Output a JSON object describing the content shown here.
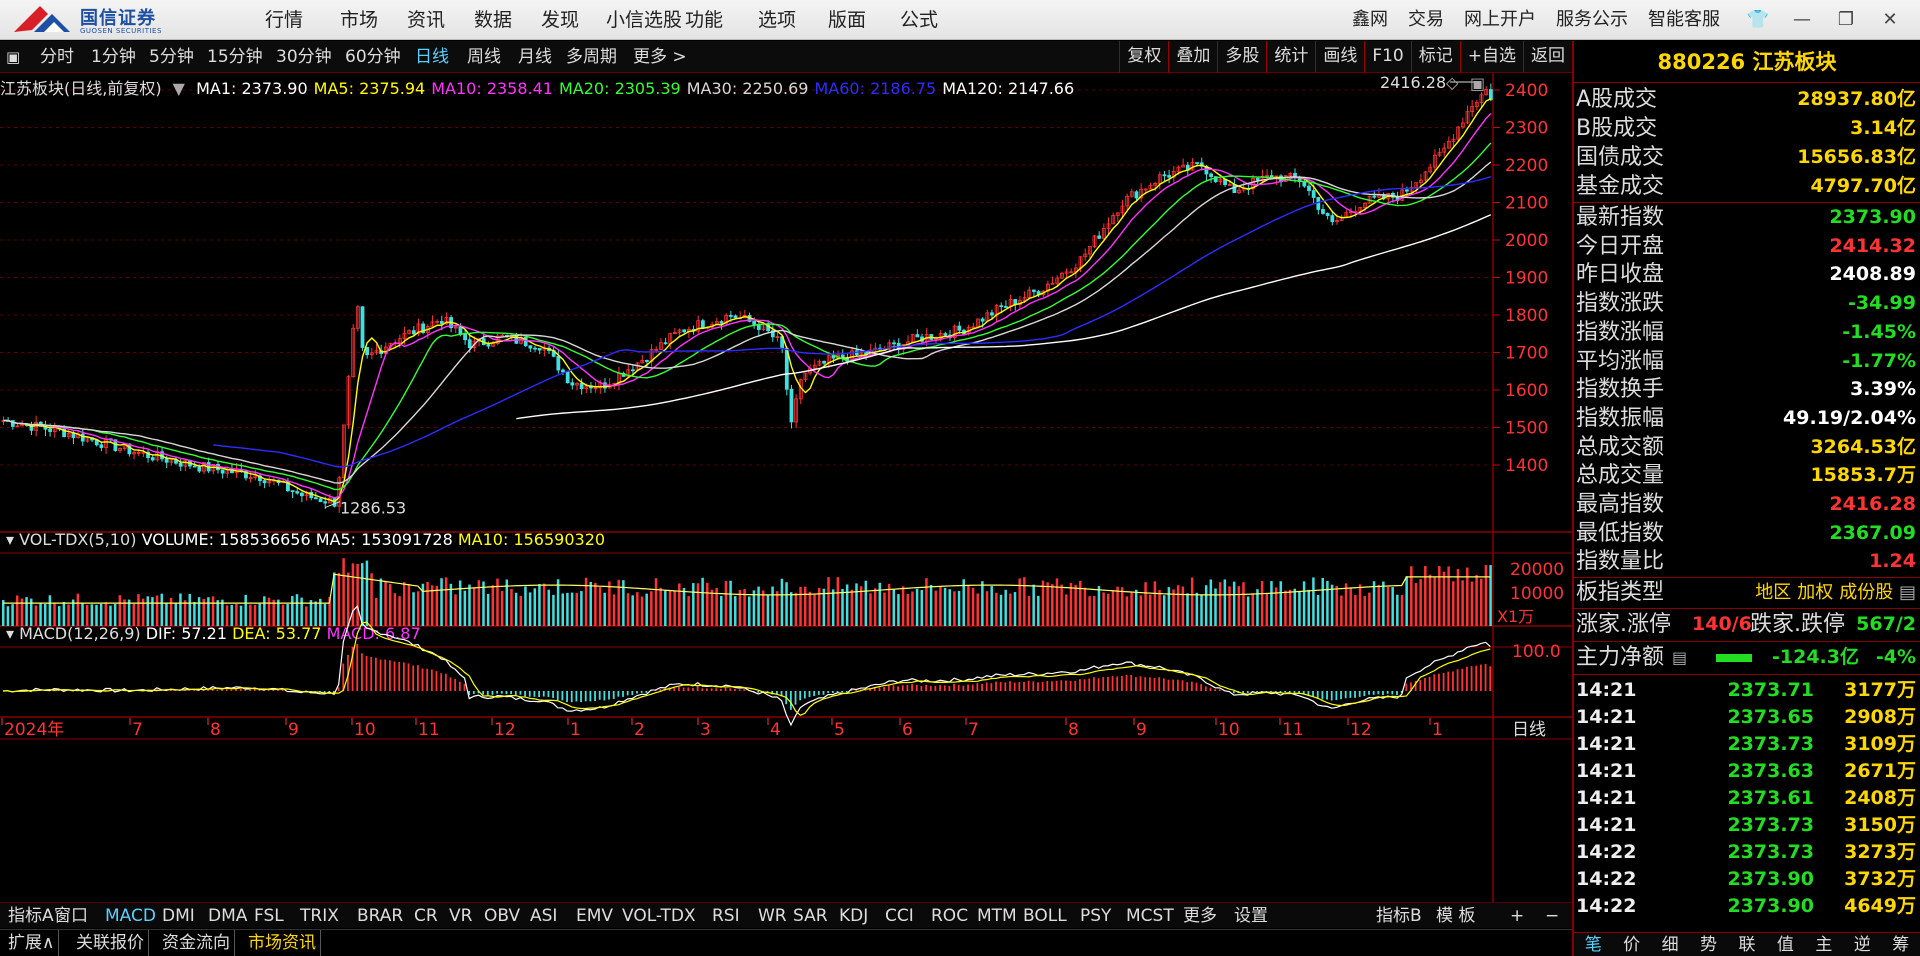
{
  "brand": {
    "name": "国信证券",
    "sub": "GUOSEN SECURITIES"
  },
  "menu": [
    "行情",
    "市场",
    "资讯",
    "数据",
    "发现",
    "小信选股",
    "功能",
    "选项",
    "版面",
    "公式"
  ],
  "right_menu": [
    "鑫网",
    "交易",
    "网上开户",
    "服务公示",
    "智能客服"
  ],
  "window_controls": [
    "shirt-icon",
    "minimize-icon",
    "restore-icon",
    "close-icon"
  ],
  "periods": [
    "分时",
    "1分钟",
    "5分钟",
    "15分钟",
    "30分钟",
    "60分钟",
    "日线",
    "周线",
    "月线",
    "多周期",
    "更多 >"
  ],
  "active_period": "日线",
  "tools": [
    "复权",
    "叠加",
    "多股",
    "统计",
    "画线",
    "F10",
    "标记",
    "+自选",
    "返回"
  ],
  "main_chart": {
    "legend_title": "江苏板块(日线,前复权)",
    "ma": [
      {
        "label": "MA1: 2373.90",
        "color": "#ffffff"
      },
      {
        "label": "MA5: 2375.94",
        "color": "#ffff00"
      },
      {
        "label": "MA10: 2358.41",
        "color": "#ff33ff"
      },
      {
        "label": "MA20: 2305.39",
        "color": "#33ff33"
      },
      {
        "label": "MA30: 2250.69",
        "color": "#d8d8d8"
      },
      {
        "label": "MA60: 2186.75",
        "color": "#2d2dff"
      },
      {
        "label": "MA120: 2147.66",
        "color": "#ffffff"
      }
    ],
    "y_ticks": [
      2400,
      2300,
      2200,
      2100,
      2000,
      1900,
      1800,
      1700,
      1600,
      1500,
      1400
    ],
    "high_label": "2416.28",
    "low_label": "1286.53"
  },
  "volume": {
    "legend_name": "VOL-TDX(5,10)",
    "legend_volume": "VOLUME: 158536656",
    "legend_ma5": "MA5: 153091728",
    "legend_ma10": "MA10: 156590320",
    "y_ticks": [
      "20000",
      "10000"
    ],
    "unit": "X1万"
  },
  "macd": {
    "legend_name": "MACD(12,26,9)",
    "legend_dif": "DIF: 57.21",
    "legend_dea": "DEA: 53.77",
    "legend_macd": "MACD: 6.87",
    "y_tick": "100.0"
  },
  "x_axis": {
    "labels": [
      "2024年",
      "7",
      "8",
      "9",
      "10",
      "11",
      "12",
      "1",
      "2",
      "3",
      "4",
      "5",
      "6",
      "7",
      "8",
      "9",
      "10",
      "11",
      "12",
      "1"
    ],
    "corner": "日线"
  },
  "indicators": [
    "指标A",
    "窗口",
    "MACD",
    "DMI",
    "DMA",
    "FSL",
    "TRIX",
    "BRAR",
    "CR",
    "VR",
    "OBV",
    "ASI",
    "EMV",
    "VOL-TDX",
    "RSI",
    "WR",
    "SAR",
    "KDJ",
    "CCI",
    "ROC",
    "MTM",
    "BOLL",
    "PSY",
    "MCST",
    "更多",
    "设置"
  ],
  "indicator_right": [
    "指标B",
    "模 板",
    "+",
    "−"
  ],
  "active_indicator": "MACD",
  "extra_tabs": [
    "扩展∧",
    "关联报价",
    "资金流向",
    "市场资讯"
  ],
  "active_extra": "市场资讯",
  "panel": {
    "title": "880226 江苏板块",
    "turnover": [
      {
        "label": "A股成交",
        "value": "28937.80亿",
        "color": "#ffd700"
      },
      {
        "label": "B股成交",
        "value": "3.14亿",
        "color": "#ffd700"
      },
      {
        "label": "国债成交",
        "value": "15656.83亿",
        "color": "#ffd700"
      },
      {
        "label": "基金成交",
        "value": "4797.70亿",
        "color": "#ffd700"
      }
    ],
    "stats": [
      {
        "label": "最新指数",
        "value": "2373.90",
        "color": "#22dd22"
      },
      {
        "label": "今日开盘",
        "value": "2414.32",
        "color": "#ff3333"
      },
      {
        "label": "昨日收盘",
        "value": "2408.89",
        "color": "#ffffff"
      },
      {
        "label": "指数涨跌",
        "value": "-34.99",
        "color": "#22dd22"
      },
      {
        "label": "指数涨幅",
        "value": "-1.45%",
        "color": "#22dd22"
      },
      {
        "label": "平均涨幅",
        "value": "-1.77%",
        "color": "#22dd22"
      },
      {
        "label": "指数换手",
        "value": "3.39%",
        "color": "#ffffff"
      },
      {
        "label": "指数振幅",
        "value": "49.19/2.04%",
        "color": "#ffffff"
      },
      {
        "label": "总成交额",
        "value": "3264.53亿",
        "color": "#ffd700"
      },
      {
        "label": "总成交量",
        "value": "15853.7万",
        "color": "#ffd700"
      },
      {
        "label": "最高指数",
        "value": "2416.28",
        "color": "#ff3333"
      },
      {
        "label": "最低指数",
        "value": "2367.09",
        "color": "#22dd22"
      },
      {
        "label": "指数量比",
        "value": "1.24",
        "color": "#ff3333"
      }
    ],
    "sector_type_label": "板指类型",
    "sector_types": [
      "地区",
      "加权",
      "成份股"
    ],
    "updown_label": "涨家.涨停",
    "updown_value": "140/6",
    "downstop_label": "跌家.跌停",
    "downstop_value": "567/2",
    "mainflow_label": "主力净额",
    "mainflow_value": "-124.3亿",
    "mainflow_pct": "-4%",
    "ticks": [
      {
        "time": "14:21",
        "price": "2373.71",
        "vol": "3177万"
      },
      {
        "time": "14:21",
        "price": "2373.65",
        "vol": "2908万"
      },
      {
        "time": "14:21",
        "price": "2373.73",
        "vol": "3109万"
      },
      {
        "time": "14:21",
        "price": "2373.63",
        "vol": "2671万"
      },
      {
        "time": "14:21",
        "price": "2373.61",
        "vol": "2408万"
      },
      {
        "time": "14:21",
        "price": "2373.73",
        "vol": "3150万"
      },
      {
        "time": "14:22",
        "price": "2373.73",
        "vol": "3273万"
      },
      {
        "time": "14:22",
        "price": "2373.90",
        "vol": "3732万"
      },
      {
        "time": "14:22",
        "price": "2373.90",
        "vol": "4649万"
      }
    ],
    "bottom_tabs": [
      "笔",
      "价",
      "细",
      "势",
      "联",
      "值",
      "主",
      "逆",
      "筹"
    ],
    "active_bottom": "笔"
  },
  "colors": {
    "up": "#ff3333",
    "down": "#40e0e0",
    "grid": "#8a0000",
    "accent": "#5ad0ff",
    "gold": "#ffd700"
  }
}
